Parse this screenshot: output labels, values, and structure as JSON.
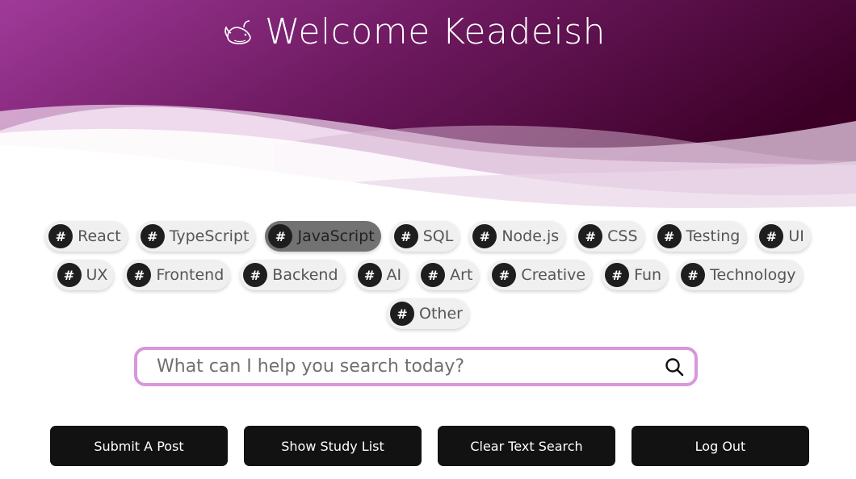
{
  "header": {
    "title": "Welcome Keadeish",
    "logo_icon": "whale-icon",
    "gradient": [
      "#9b3596",
      "#6e1a5e",
      "#3d0028"
    ]
  },
  "tags": [
    {
      "label": "React",
      "active": false
    },
    {
      "label": "TypeScript",
      "active": false
    },
    {
      "label": "JavaScript",
      "active": true
    },
    {
      "label": "SQL",
      "active": false
    },
    {
      "label": "Node.js",
      "active": false
    },
    {
      "label": "CSS",
      "active": false
    },
    {
      "label": "Testing",
      "active": false
    },
    {
      "label": "UI",
      "active": false
    },
    {
      "label": "UX",
      "active": false
    },
    {
      "label": "Frontend",
      "active": false
    },
    {
      "label": "Backend",
      "active": false
    },
    {
      "label": "AI",
      "active": false
    },
    {
      "label": "Art",
      "active": false
    },
    {
      "label": "Creative",
      "active": false
    },
    {
      "label": "Fun",
      "active": false
    },
    {
      "label": "Technology",
      "active": false
    },
    {
      "label": "Other",
      "active": false
    }
  ],
  "tag_symbol": "#",
  "search": {
    "placeholder": "What can I help you search today?",
    "value": "",
    "icon": "search-icon",
    "border_color": "#d896dc"
  },
  "actions": {
    "submit_post": "Submit A Post",
    "show_study_list": "Show Study List",
    "clear_text_search": "Clear Text Search",
    "log_out": "Log Out"
  }
}
